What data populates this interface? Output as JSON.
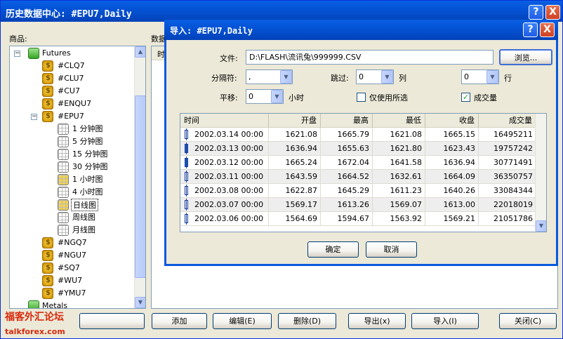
{
  "window": {
    "title": "历史数据中心: #EPU7,Daily",
    "help": "?",
    "close": "X"
  },
  "labels": {
    "symbols": "商品:",
    "data": "数据"
  },
  "tree": {
    "root": {
      "label": "Futures"
    },
    "items": [
      {
        "label": "#CLQ7"
      },
      {
        "label": "#CLU7"
      },
      {
        "label": "#CU7"
      },
      {
        "label": "#ENQU7"
      },
      {
        "label": "#EPU7"
      }
    ],
    "periods": [
      {
        "label": "1 分钟图"
      },
      {
        "label": "5 分钟图"
      },
      {
        "label": "15 分钟图"
      },
      {
        "label": "30 分钟图"
      },
      {
        "label": "1 小时图"
      },
      {
        "label": "4 小时图"
      },
      {
        "label": "日线图"
      },
      {
        "label": "周线图"
      },
      {
        "label": "月线图"
      }
    ],
    "after": [
      {
        "label": "#NGQ7"
      },
      {
        "label": "#NGU7"
      },
      {
        "label": "#SQ7"
      },
      {
        "label": "#WU7"
      },
      {
        "label": "#YMU7"
      }
    ],
    "metals": {
      "label": "Metals"
    }
  },
  "bottom_buttons": {
    "add": "添加",
    "edit": "编辑(E)",
    "delete": "删除(D)",
    "export": "导出(x)",
    "import": "导入(I)",
    "close": "关闭(C)"
  },
  "background_list_header": "时",
  "dialog": {
    "title": "导入: #EPU7,Daily",
    "help": "?",
    "close": "X",
    "file_label": "文件:",
    "file_value": "D:\\FLASH\\流讯兔\\999999.CSV",
    "browse": "浏览...",
    "sep_label": "分隔符:",
    "sep_value": ",",
    "skip_label": "跳过:",
    "skip_value": "0",
    "cols_label": "列",
    "rows_value": "0",
    "rows_label": "行",
    "shift_label": "平移:",
    "shift_value": "0",
    "hours_label": "小时",
    "only_selected": "仅使用所选",
    "only_selected_checked": false,
    "volume": "成交量",
    "volume_checked": true,
    "table": {
      "headers": [
        "时间",
        "开盘",
        "最高",
        "最低",
        "收盘",
        "成交量"
      ],
      "rows": [
        [
          "2002.03.14 00:00",
          "1621.08",
          "1665.79",
          "1621.08",
          "1665.15",
          "16495211"
        ],
        [
          "2002.03.13 00:00",
          "1636.94",
          "1655.63",
          "1621.80",
          "1623.43",
          "19757242"
        ],
        [
          "2002.03.12 00:00",
          "1665.24",
          "1672.04",
          "1641.58",
          "1636.94",
          "30771491"
        ],
        [
          "2002.03.11 00:00",
          "1643.59",
          "1664.52",
          "1632.61",
          "1664.09",
          "36350757"
        ],
        [
          "2002.03.08 00:00",
          "1622.87",
          "1645.29",
          "1611.23",
          "1640.26",
          "33084344"
        ],
        [
          "2002.03.07 00:00",
          "1569.17",
          "1613.26",
          "1569.07",
          "1613.00",
          "22018019"
        ],
        [
          "2002.03.06 00:00",
          "1564.69",
          "1594.67",
          "1563.92",
          "1569.21",
          "21051786"
        ]
      ]
    },
    "ok": "确定",
    "cancel": "取消"
  },
  "watermark": {
    "line1": "福客外汇论坛",
    "line2": "talkforex.com"
  }
}
